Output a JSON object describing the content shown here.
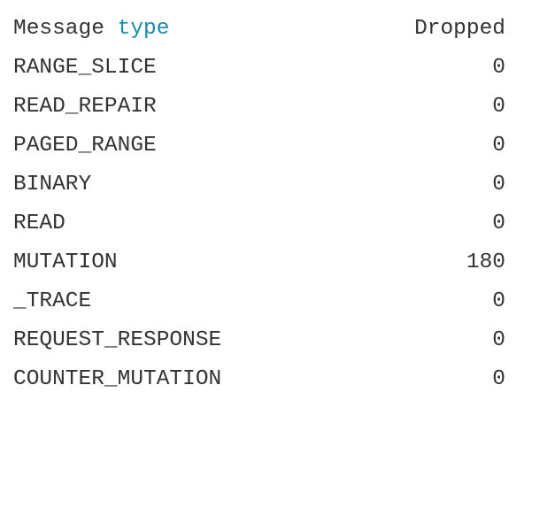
{
  "header": {
    "label_plain": "Message ",
    "label_highlight": "type",
    "value_label": "Dropped",
    "highlight_color": "#1a8aaa"
  },
  "rows": [
    {
      "name": "RANGE_SLICE",
      "dropped": "0"
    },
    {
      "name": "READ_REPAIR",
      "dropped": "0"
    },
    {
      "name": "PAGED_RANGE",
      "dropped": "0"
    },
    {
      "name": "BINARY",
      "dropped": "0"
    },
    {
      "name": "READ",
      "dropped": "0"
    },
    {
      "name": "MUTATION",
      "dropped": "180"
    },
    {
      "name": "_TRACE",
      "dropped": "0"
    },
    {
      "name": "REQUEST_RESPONSE",
      "dropped": "0"
    },
    {
      "name": "COUNTER_MUTATION",
      "dropped": "0"
    }
  ]
}
